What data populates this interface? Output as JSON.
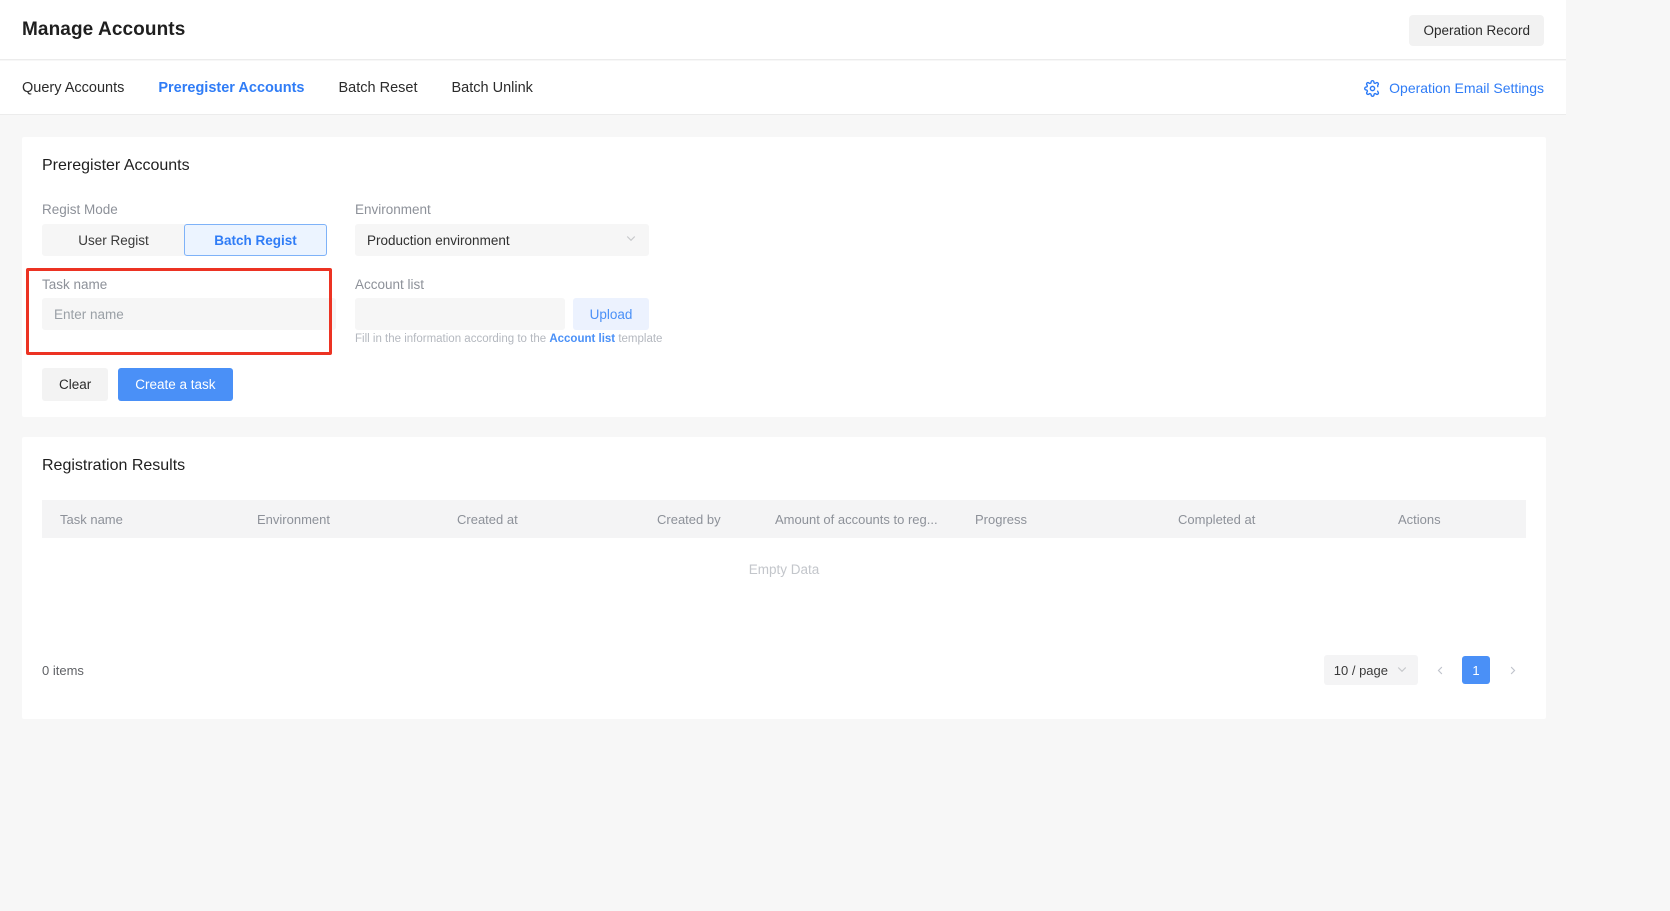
{
  "header": {
    "title": "Manage Accounts",
    "operation_record_label": "Operation Record"
  },
  "tabs": [
    {
      "label": "Query Accounts",
      "active": false
    },
    {
      "label": "Preregister Accounts",
      "active": true
    },
    {
      "label": "Batch Reset",
      "active": false
    },
    {
      "label": "Batch Unlink",
      "active": false
    }
  ],
  "email_settings": {
    "label": "Operation Email Settings",
    "icon": "gear-icon"
  },
  "form": {
    "card_title": "Preregister Accounts",
    "regist_mode": {
      "label": "Regist Mode",
      "options": [
        "User Regist",
        "Batch Regist"
      ],
      "selected": "Batch Regist"
    },
    "environment": {
      "label": "Environment",
      "value": "Production environment",
      "icon": "chevron-down-icon"
    },
    "task_name": {
      "label": "Task name",
      "value": "",
      "placeholder": "Enter name",
      "highlighted": true
    },
    "account_list": {
      "label": "Account list",
      "value": "",
      "placeholder": "",
      "upload_label": "Upload",
      "hint_prefix": "Fill in the information according to the ",
      "hint_link": "Account list",
      "hint_suffix": " template"
    },
    "buttons": {
      "clear_label": "Clear",
      "create_label": "Create a task"
    }
  },
  "results": {
    "card_title": "Registration Results",
    "columns": [
      "Task name",
      "Environment",
      "Created at",
      "Created by",
      "Amount of accounts to reg...",
      "Progress",
      "Completed at",
      "Actions"
    ],
    "rows": [],
    "empty_text": "Empty Data",
    "items_count_text": "0 items",
    "pagination": {
      "page_size_label": "10 / page",
      "page_size_icon": "chevron-down-icon",
      "prev_icon": "chevron-left-icon",
      "next_icon": "chevron-right-icon",
      "current_page": "1"
    }
  },
  "colors": {
    "accent": "#4a90f7",
    "tab_active": "#2f7cf6",
    "highlight": "#ec3323",
    "page_bg": "#f7f7f7",
    "field_bg": "#f6f6f6"
  }
}
